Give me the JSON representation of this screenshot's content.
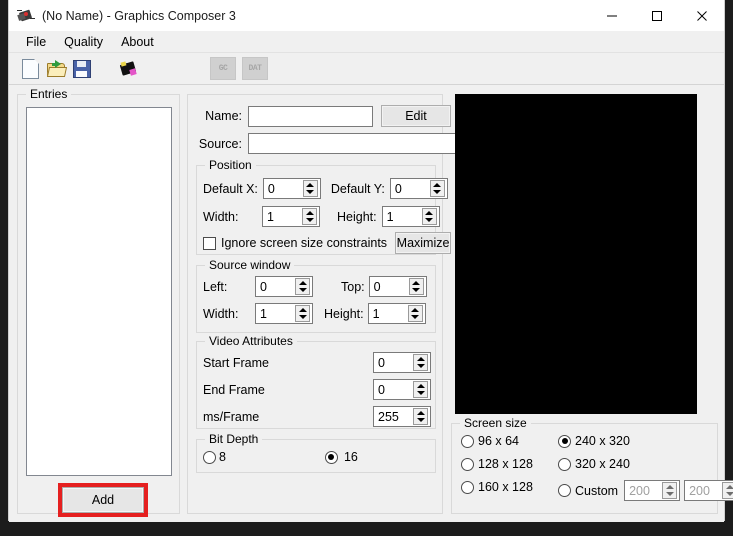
{
  "window": {
    "title": "(No Name) - Graphics Composer 3",
    "icon": "app-chip-icon",
    "caption_buttons": [
      {
        "name": "minimize",
        "glyph": "minimize-icon"
      },
      {
        "name": "maximize",
        "glyph": "maximize-icon"
      },
      {
        "name": "close",
        "glyph": "close-icon"
      }
    ]
  },
  "menubar": {
    "items": [
      {
        "label": "File"
      },
      {
        "label": "Quality"
      },
      {
        "label": "About"
      }
    ]
  },
  "toolbar": {
    "buttons": [
      {
        "name": "new-file-icon",
        "label": ""
      },
      {
        "name": "open-folder-icon",
        "label": ""
      },
      {
        "name": "save-icon",
        "label": ""
      },
      {
        "name": "chip-icon",
        "label": ""
      }
    ],
    "disabled_buttons": [
      {
        "name": "gc-export-button",
        "label": "GC"
      },
      {
        "name": "dat-export-button",
        "label": "DAT"
      }
    ]
  },
  "entries": {
    "legend": "Entries",
    "items": [],
    "add_label": "Add",
    "highlight_color": "#e52020"
  },
  "details": {
    "name_label": "Name:",
    "name_value": "",
    "edit_label": "Edit",
    "source_label": "Source:",
    "source_value": "",
    "position": {
      "legend": "Position",
      "default_x_label": "Default X:",
      "default_x_value": "0",
      "default_y_label": "Default Y:",
      "default_y_value": "0",
      "width_label": "Width:",
      "width_value": "1",
      "height_label": "Height:",
      "height_value": "1",
      "ignore_label": "Ignore screen size constraints",
      "ignore_checked": false,
      "maximize_label": "Maximize"
    },
    "source_window": {
      "legend": "Source window",
      "left_label": "Left:",
      "left_value": "0",
      "top_label": "Top:",
      "top_value": "0",
      "width_label": "Width:",
      "width_value": "1",
      "height_label": "Height:",
      "height_value": "1"
    },
    "video": {
      "legend": "Video Attributes",
      "start_frame_label": "Start Frame",
      "start_frame_value": "0",
      "end_frame_label": "End Frame",
      "end_frame_value": "0",
      "ms_frame_label": "ms/Frame",
      "ms_frame_value": "255"
    },
    "bit_depth": {
      "legend": "Bit Depth",
      "option_8_label": "8",
      "option_8_selected": false,
      "option_16_label": "16",
      "option_16_selected": true
    }
  },
  "preview": {
    "name": "preview-canvas",
    "background": "#000000"
  },
  "screen_size": {
    "legend": "Screen size",
    "options": [
      {
        "label": "96 x 64",
        "selected": false
      },
      {
        "label": "128 x 128",
        "selected": false
      },
      {
        "label": "160 x 128",
        "selected": false
      },
      {
        "label": "240 x 320",
        "selected": true
      },
      {
        "label": "320 x 240",
        "selected": false
      },
      {
        "label": "Custom",
        "selected": false
      }
    ],
    "custom_width": "200",
    "custom_height": "200"
  }
}
